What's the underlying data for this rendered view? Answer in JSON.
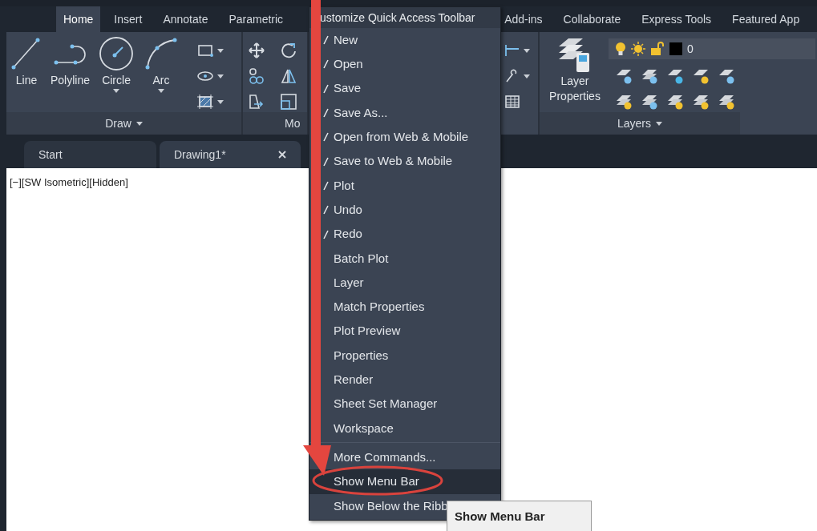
{
  "ribbon": {
    "tabs": [
      {
        "label": "Home",
        "selected": true
      },
      {
        "label": "Insert",
        "selected": false
      },
      {
        "label": "Annotate",
        "selected": false
      },
      {
        "label": "Parametric",
        "selected": false
      },
      {
        "label": "Add-ins",
        "selected": false
      },
      {
        "label": "Collaborate",
        "selected": false
      },
      {
        "label": "Express Tools",
        "selected": false
      },
      {
        "label": "Featured App",
        "selected": false
      }
    ],
    "draw_panel": {
      "title": "Draw",
      "tools": [
        {
          "label": "Line",
          "dropdown": false
        },
        {
          "label": "Polyline",
          "dropdown": false
        },
        {
          "label": "Circle",
          "dropdown": true
        },
        {
          "label": "Arc",
          "dropdown": true
        }
      ]
    },
    "modify_panel": {
      "title": "Mo"
    },
    "layers_panel": {
      "title": "Layers",
      "layer_properties": "Layer Properties",
      "current_layer": "0"
    }
  },
  "document_tabs": [
    {
      "label": "Start",
      "selected": false
    },
    {
      "label": "Drawing1*",
      "selected": true
    }
  ],
  "viewport_label": "[−][SW Isometric][Hidden]",
  "quick_access_menu": {
    "title": "ustomize Quick Access Toolbar",
    "items": [
      {
        "label": "New",
        "checked": true
      },
      {
        "label": "Open",
        "checked": true
      },
      {
        "label": "Save",
        "checked": true
      },
      {
        "label": "Save As...",
        "checked": true
      },
      {
        "label": "Open from Web & Mobile",
        "checked": true
      },
      {
        "label": "Save to Web & Mobile",
        "checked": true
      },
      {
        "label": "Plot",
        "checked": true
      },
      {
        "label": "Undo",
        "checked": true
      },
      {
        "label": "Redo",
        "checked": true
      },
      {
        "label": "Batch Plot",
        "checked": false
      },
      {
        "label": "Layer",
        "checked": false
      },
      {
        "label": "Match Properties",
        "checked": false
      },
      {
        "label": "Plot Preview",
        "checked": false
      },
      {
        "label": "Properties",
        "checked": false
      },
      {
        "label": "Render",
        "checked": false
      },
      {
        "label": "Sheet Set Manager",
        "checked": false
      },
      {
        "label": "Workspace",
        "checked": false
      }
    ],
    "extra_items": [
      {
        "label": "More Commands...",
        "selected": false
      },
      {
        "label": "Show Menu Bar",
        "selected": true
      },
      {
        "label": "Show Below the Ribb",
        "selected": false
      }
    ]
  },
  "tooltip": {
    "text": "Show Menu Bar"
  }
}
